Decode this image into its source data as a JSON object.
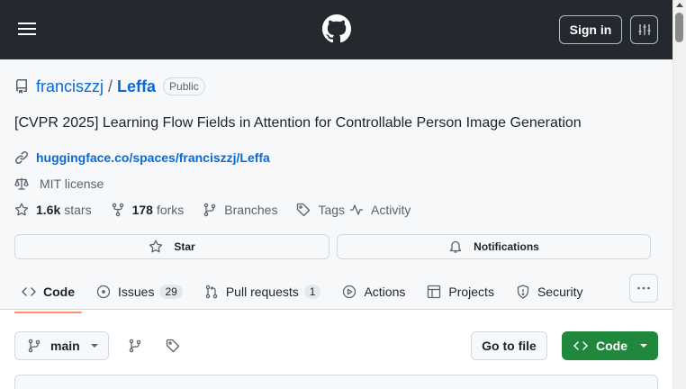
{
  "header": {
    "signin_label": "Sign in"
  },
  "repo": {
    "owner": "franciszzj",
    "separator": "/",
    "name": "Leffa",
    "visibility": "Public",
    "description": "[CVPR 2025] Learning Flow Fields in Attention for Controllable Person Image Generation",
    "website": "huggingface.co/spaces/franciszzj/Leffa",
    "license": "MIT license"
  },
  "stats": {
    "stars_count": "1.6k",
    "stars_label": "stars",
    "forks_count": "178",
    "forks_label": "forks",
    "branches_label": "Branches",
    "tags_label": "Tags",
    "activity_label": "Activity"
  },
  "actions": {
    "star_label": "Star",
    "notifications_label": "Notifications"
  },
  "tabs": [
    {
      "label": "Code",
      "icon": "code-icon"
    },
    {
      "label": "Issues",
      "icon": "issue-icon",
      "count": "29"
    },
    {
      "label": "Pull requests",
      "icon": "pull-request-icon",
      "count": "1"
    },
    {
      "label": "Actions",
      "icon": "play-icon"
    },
    {
      "label": "Projects",
      "icon": "table-icon"
    },
    {
      "label": "Security",
      "icon": "shield-icon"
    }
  ],
  "toolbar": {
    "branch": "main",
    "goto_file_label": "Go to file",
    "code_label": "Code"
  },
  "colors": {
    "header_bg": "#24292f",
    "link": "#0969da",
    "code_btn": "#1f883d",
    "active_tab": "#fd8c73"
  }
}
